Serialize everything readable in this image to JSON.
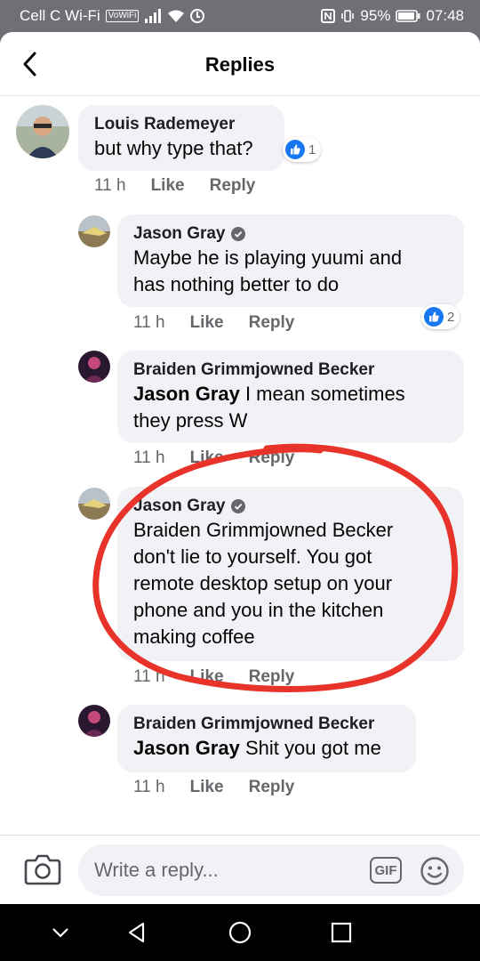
{
  "status_bar": {
    "carrier": "Cell C Wi-Fi",
    "volte": "VoWiFi",
    "battery": "95%",
    "time": "07:48"
  },
  "header": {
    "title": "Replies",
    "back_icon": "chevron-left-icon"
  },
  "comments": [
    {
      "author": "Louis Rademeyer",
      "verified": false,
      "mention": "",
      "text": "but why type that?",
      "time": "11 h",
      "like_label": "Like",
      "reply_label": "Reply",
      "reaction_count": "1"
    },
    {
      "author": "Jason Gray",
      "verified": true,
      "mention": "",
      "text_line1": "Maybe he is playing yuumi and",
      "text_line2": "has nothing better to do",
      "time": "11 h",
      "like_label": "Like",
      "reply_label": "Reply",
      "reaction_count": "2"
    },
    {
      "author": "Braiden Grimmjowned Becker",
      "verified": false,
      "mention": "Jason Gray",
      "text_line1": " I mean sometimes",
      "text_line2": "they press W",
      "time": "11 h",
      "like_label": "Like",
      "reply_label": "Reply"
    },
    {
      "author": "Jason Gray",
      "verified": true,
      "mention": "Braiden Grimmjowned Becker",
      "text_line1": "don't lie to yourself. You got",
      "text_line2": "remote desktop setup on your",
      "text_line3": "phone and you in the kitchen",
      "text_line4": "making coffee",
      "time": "11 h",
      "like_label": "Like",
      "reply_label": "Reply"
    },
    {
      "author": "Braiden Grimmjowned Becker",
      "verified": false,
      "mention": "Jason Gray",
      "text": " Shit you got me",
      "time": "11 h",
      "like_label": "Like",
      "reply_label": "Reply"
    }
  ],
  "composer": {
    "placeholder": "Write a reply...",
    "gif_label": "GIF",
    "camera_icon": "camera-icon",
    "emoji_icon": "smiley-icon"
  },
  "colors": {
    "like_blue": "#1877f2",
    "bubble": "#f0f2f5",
    "meta_gray": "#65676b",
    "annotation_red": "#e8332a"
  }
}
